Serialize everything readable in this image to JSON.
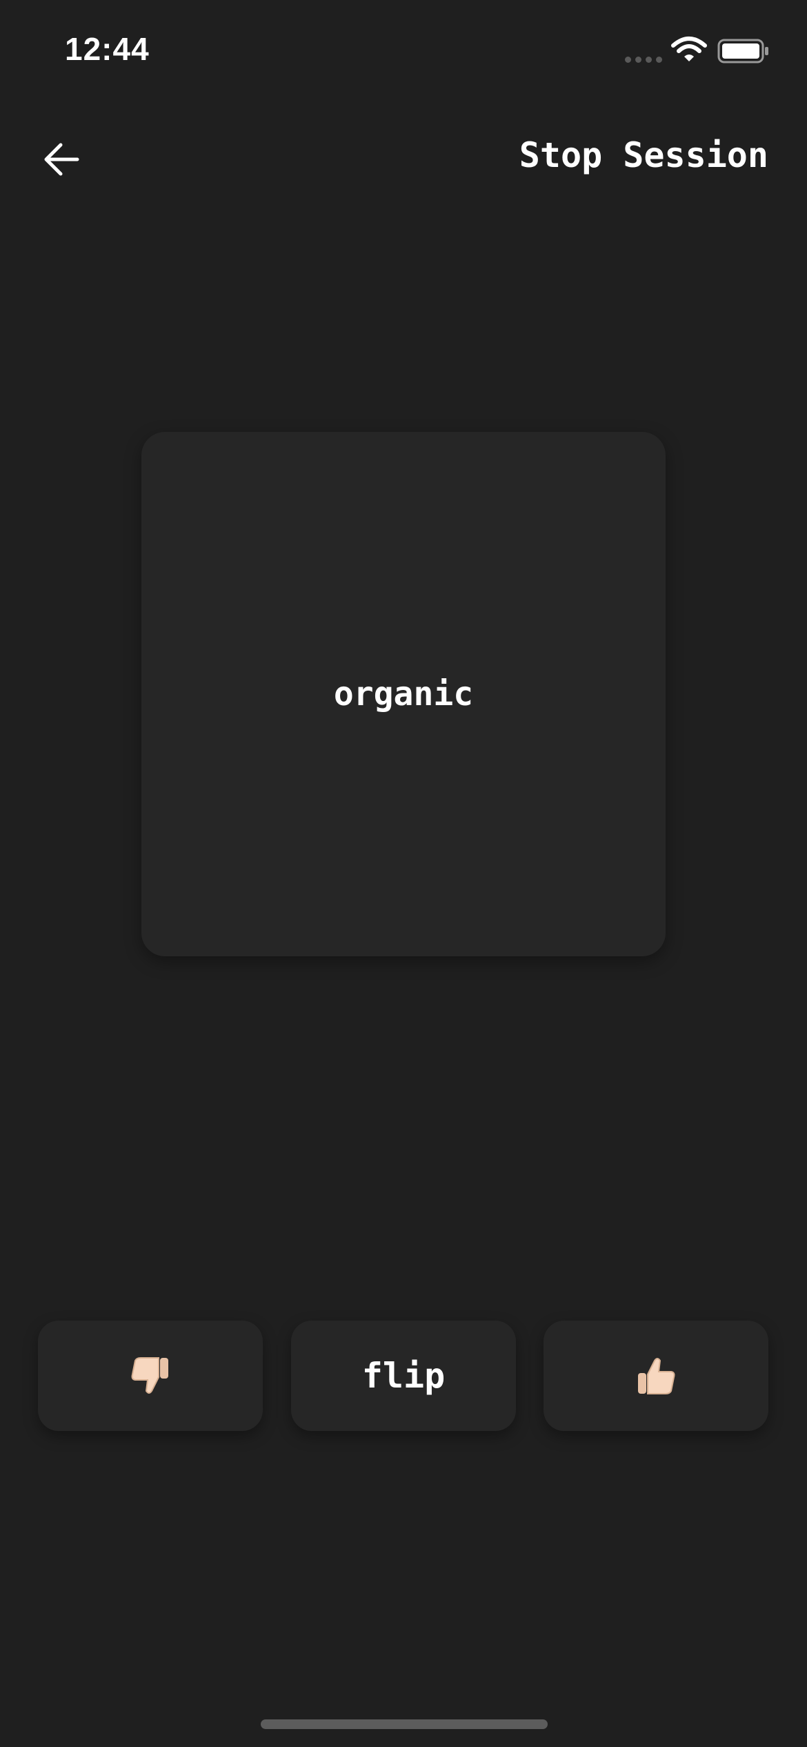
{
  "status_bar": {
    "time": "12:44",
    "icons": [
      "cellular-signal-icon",
      "wifi-icon",
      "battery-icon"
    ]
  },
  "nav": {
    "back_icon": "arrow-left-icon",
    "stop_session_label": "Stop Session"
  },
  "card": {
    "word": "organic"
  },
  "actions": {
    "dislike_icon": "thumbs-down-icon",
    "flip_label": "flip",
    "like_icon": "thumbs-up-icon"
  },
  "colors": {
    "background": "#1f1f1f",
    "surface": "#262626",
    "text": "#ffffff",
    "thumb_skin": "#f7d7bf"
  }
}
